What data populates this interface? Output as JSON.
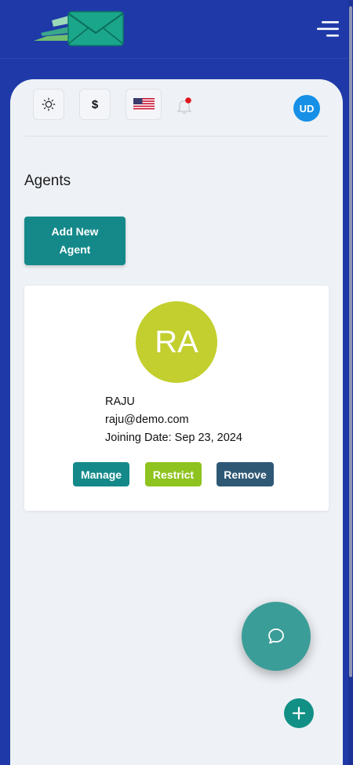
{
  "header": {
    "logo_icon": "envelope-logo-icon",
    "menu_icon": "hamburger-menu-icon"
  },
  "toolbar": {
    "theme_icon": "sun-icon",
    "currency_symbol": "$",
    "language_icon": "us-flag-icon",
    "notification_icon": "bell-icon",
    "notification_dot_color": "#e0161e",
    "user_initials": "UD"
  },
  "page": {
    "title": "Agents",
    "add_button_label": "Add New Agent"
  },
  "agents": [
    {
      "initials": "RA",
      "name": "RAJU",
      "email": "raju@demo.com",
      "joining_date": "Joining Date: Sep 23, 2024",
      "avatar_color": "#c2cf2e",
      "actions": {
        "manage": "Manage",
        "restrict": "Restrict",
        "remove": "Remove"
      }
    }
  ],
  "colors": {
    "brand_blue": "#1f3aa8",
    "teal": "#15898a",
    "restrict_green": "#8fc31f",
    "remove_slate": "#2f5874",
    "user_badge": "#1590e6"
  },
  "fabs": {
    "chat_icon": "chat-bubble-icon",
    "add_icon": "plus-icon"
  }
}
